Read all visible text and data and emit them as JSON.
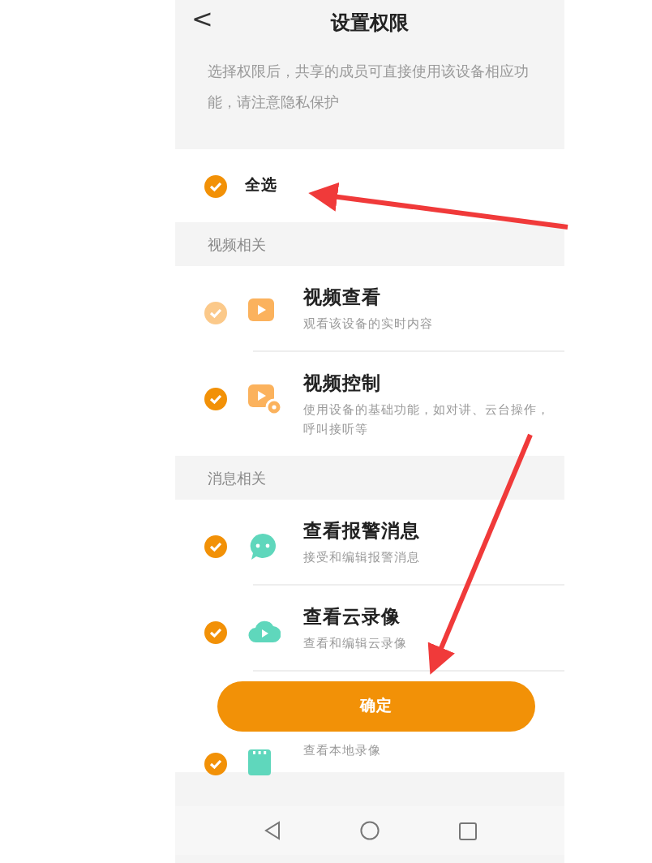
{
  "header": {
    "back": "<",
    "title": "设置权限"
  },
  "notice": "选择权限后，共享的成员可直接使用该设备相应功能，请注意隐私保护",
  "select_all": {
    "label": "全选",
    "checked": true
  },
  "sections": [
    {
      "title": "视频相关",
      "items": [
        {
          "kind": "play",
          "title": "视频查看",
          "subtitle": "观看该设备的实时内容",
          "checked": true,
          "disabled": true
        },
        {
          "kind": "control",
          "title": "视频控制",
          "subtitle": "使用设备的基础功能，如对讲、云台操作，呼叫接听等",
          "checked": true,
          "disabled": false
        }
      ]
    },
    {
      "title": "消息相关",
      "items": [
        {
          "kind": "chat",
          "title": "查看报警消息",
          "subtitle": "接受和编辑报警消息",
          "checked": true,
          "disabled": false
        },
        {
          "kind": "cloud",
          "title": "查看云录像",
          "subtitle": "查看和编辑云录像",
          "checked": true,
          "disabled": false
        },
        {
          "kind": "local",
          "subtitle": "查看本地录像",
          "checked": true,
          "disabled": false
        }
      ]
    }
  ],
  "confirm_button": "确定"
}
